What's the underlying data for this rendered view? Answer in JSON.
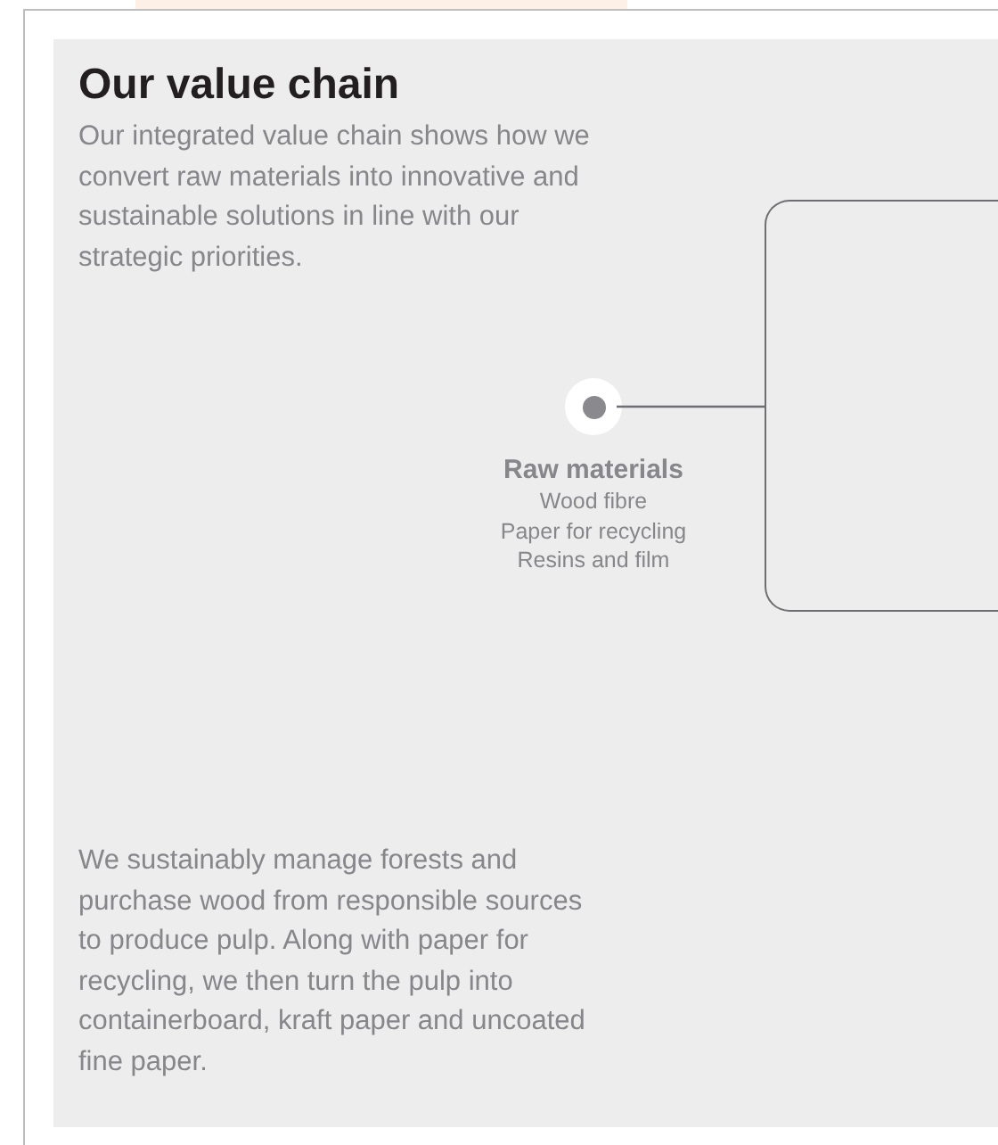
{
  "title": "Our value chain",
  "intro": "Our integrated value chain shows how we convert raw materials into innovative and sustainable solutions in line with our strategic priorities.",
  "node": {
    "label": "Raw materials",
    "items": [
      "Wood fibre",
      "Paper for recycling",
      "Resins and film"
    ]
  },
  "description": "We sustainably manage forests and purchase wood from responsible sources to produce pulp. Along with paper for recycling, we then turn the pulp into containerboard, kraft paper and uncoated fine paper."
}
